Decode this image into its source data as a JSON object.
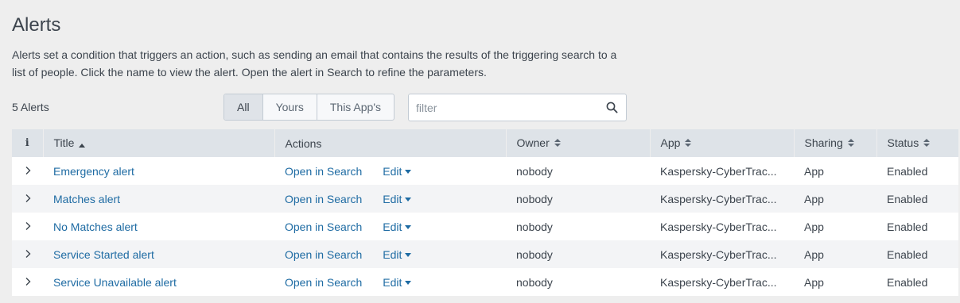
{
  "page": {
    "title": "Alerts",
    "description": "Alerts set a condition that triggers an action, such as sending an email that contains the results of the triggering search to a list of people. Click the name to view the alert. Open the alert in Search to refine the parameters.",
    "count_label": "5 Alerts"
  },
  "filter_tabs": [
    {
      "label": "All",
      "active": true
    },
    {
      "label": "Yours",
      "active": false
    },
    {
      "label": "This App's",
      "active": false
    }
  ],
  "search": {
    "placeholder": "filter",
    "value": ""
  },
  "table": {
    "headers": {
      "info": "i",
      "title": "Title",
      "actions": "Actions",
      "owner": "Owner",
      "app": "App",
      "sharing": "Sharing",
      "status": "Status"
    },
    "rows": [
      {
        "title": "Emergency alert",
        "open_label": "Open in Search",
        "edit_label": "Edit",
        "owner": "nobody",
        "app": "Kaspersky-CyberTrac...",
        "sharing": "App",
        "status": "Enabled"
      },
      {
        "title": "Matches alert",
        "open_label": "Open in Search",
        "edit_label": "Edit",
        "owner": "nobody",
        "app": "Kaspersky-CyberTrac...",
        "sharing": "App",
        "status": "Enabled"
      },
      {
        "title": "No Matches alert",
        "open_label": "Open in Search",
        "edit_label": "Edit",
        "owner": "nobody",
        "app": "Kaspersky-CyberTrac...",
        "sharing": "App",
        "status": "Enabled"
      },
      {
        "title": "Service Started alert",
        "open_label": "Open in Search",
        "edit_label": "Edit",
        "owner": "nobody",
        "app": "Kaspersky-CyberTrac...",
        "sharing": "App",
        "status": "Enabled"
      },
      {
        "title": "Service Unavailable alert",
        "open_label": "Open in Search",
        "edit_label": "Edit",
        "owner": "nobody",
        "app": "Kaspersky-CyberTrac...",
        "sharing": "App",
        "status": "Enabled"
      }
    ]
  },
  "colors": {
    "link": "#1e6ba3",
    "text": "#3c444d",
    "header_bg": "#dee3e8",
    "page_bg": "#eeeeee"
  },
  "icons": {
    "search": "search-icon",
    "expand": "chevron-right-icon",
    "sort_asc": "sort-asc-icon",
    "sortable": "sort-both-icon",
    "edit_menu": "caret-down-icon"
  }
}
